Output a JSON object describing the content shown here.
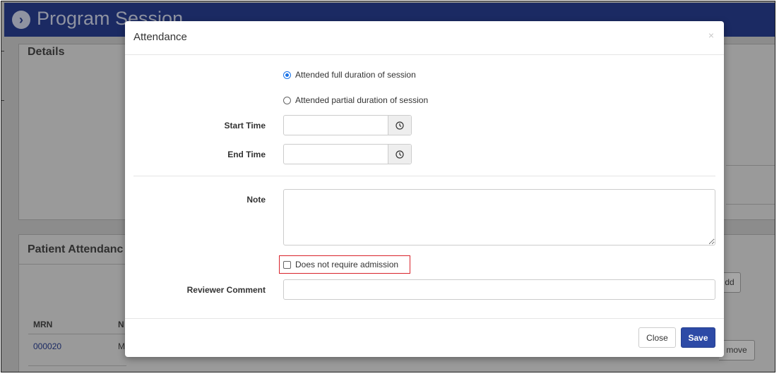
{
  "page": {
    "title": "Program Session",
    "details_heading": "Details",
    "attendance_heading": "Patient Attendanc",
    "table": {
      "col_mrn": "MRN",
      "col_name_partial": "N",
      "row_mrn": "000020",
      "row_name_partial": "M"
    },
    "add_button_partial": "dd",
    "remove_button_partial": "move"
  },
  "modal": {
    "title": "Attendance",
    "close_icon_glyph": "×",
    "radio_full": "Attended full duration of session",
    "radio_partial": "Attended partial duration of session",
    "selected_option": "full",
    "start_time_label": "Start Time",
    "start_time_value": "",
    "end_time_label": "End Time",
    "end_time_value": "",
    "note_label": "Note",
    "note_value": "",
    "no_admission_label": "Does not require admission",
    "no_admission_checked": false,
    "reviewer_label": "Reviewer Comment",
    "reviewer_value": "",
    "close_button": "Close",
    "save_button": "Save"
  },
  "colors": {
    "header_bg": "#1b2a63",
    "save_button": "#2d4aa6",
    "highlight_outline": "#d9232b",
    "radio_selected": "#1a73e8"
  },
  "icons": {
    "header": "chevron-right-circle-icon",
    "time_addon": "clock-icon",
    "modal_close": "close-icon"
  }
}
